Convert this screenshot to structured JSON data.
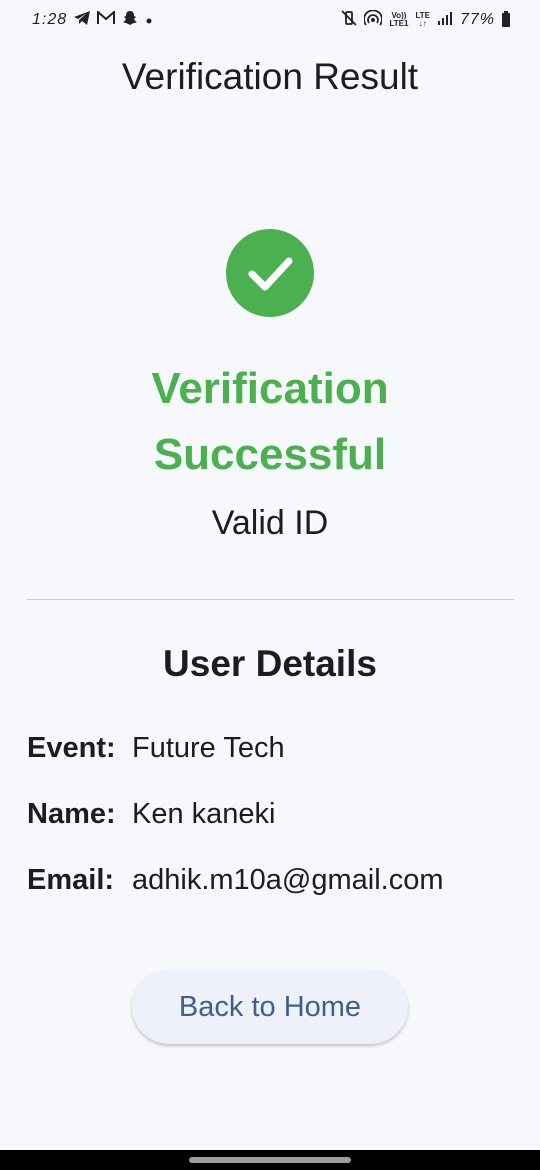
{
  "status_bar": {
    "time": "1:28",
    "left_icons": [
      "telegram-icon",
      "gmail-icon",
      "snapchat-icon",
      "dot-icon"
    ],
    "right_icons": [
      "mute-vibrate-icon",
      "hotspot-icon",
      "volte-icon",
      "lte-icon",
      "signal-icon",
      "battery-icon"
    ],
    "volte_top": "Vo))",
    "volte_bottom": "LTE1",
    "lte_top": "LTE",
    "lte_bottom": "↓↑",
    "battery_percent": "77%"
  },
  "header": {
    "title": "Verification Result"
  },
  "result": {
    "icon": "check-circle-icon",
    "status_line1": "Verification",
    "status_line2": "Successful",
    "subtitle": "Valid ID",
    "color": "#4caf50"
  },
  "user_details": {
    "title": "User Details",
    "rows": [
      {
        "label": "Event:",
        "value": "Future Tech"
      },
      {
        "label": "Name:",
        "value": "Ken kaneki"
      },
      {
        "label": "Email:",
        "value": "adhik.m10a@gmail.com"
      }
    ]
  },
  "actions": {
    "home_label": "Back to Home"
  }
}
